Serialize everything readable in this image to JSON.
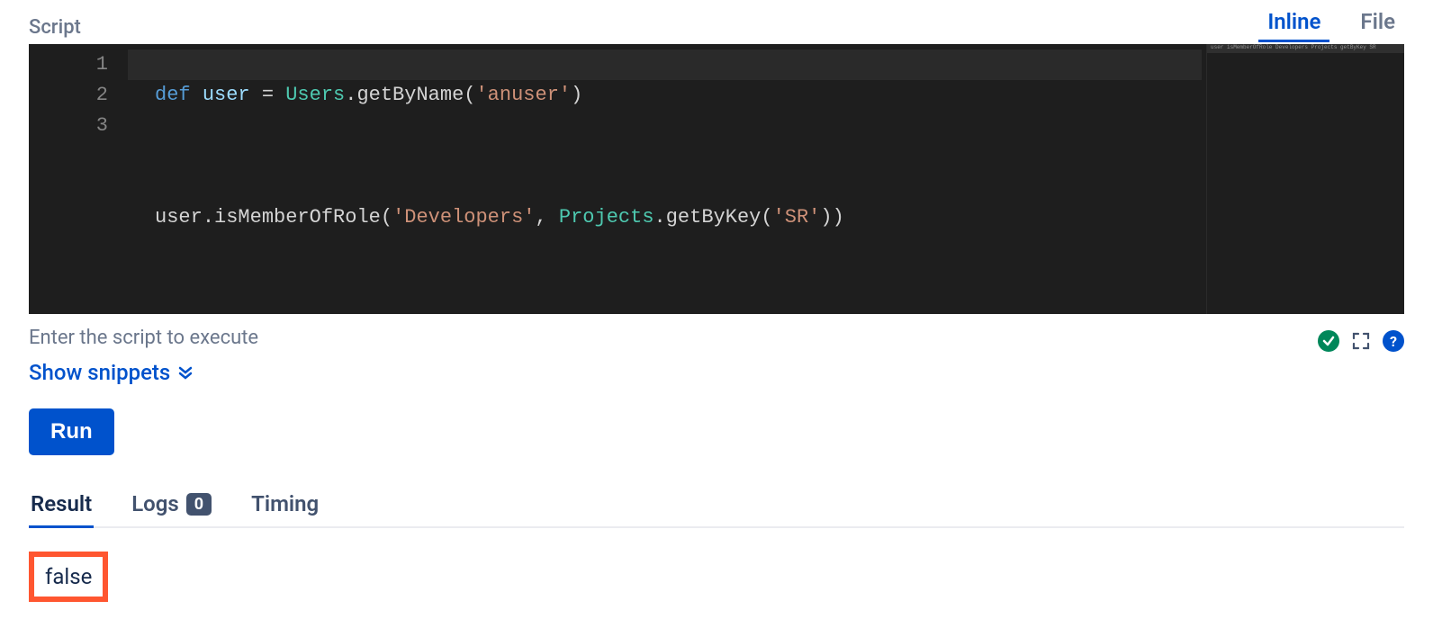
{
  "header": {
    "label": "Script",
    "tabs": [
      {
        "label": "Inline",
        "active": true
      },
      {
        "label": "File",
        "active": false
      }
    ]
  },
  "editor": {
    "lines": [
      "1",
      "2",
      "3"
    ],
    "code_tokens": {
      "line1": {
        "def": "def",
        "sp1": " ",
        "user": "user",
        "sp2": " ",
        "eq": "=",
        "sp3": " ",
        "Users": "Users",
        "dot": ".",
        "getByName": "getByName",
        "lp": "(",
        "str": "'anuser'",
        "rp": ")"
      },
      "line3": {
        "user": "user",
        "dot1": ".",
        "isMember": "isMemberOfRole",
        "lp1": "(",
        "str1": "'Developers'",
        "comma": ",",
        "sp": " ",
        "Projects": "Projects",
        "dot2": ".",
        "getByKey": "getByKey",
        "lp2": "(",
        "str2": "'SR'",
        "rp2": ")",
        "rp1": ")"
      }
    }
  },
  "below": {
    "help": "Enter the script to execute",
    "snippets": "Show snippets"
  },
  "actions": {
    "run": "Run"
  },
  "result_tabs": {
    "result": "Result",
    "logs": "Logs",
    "logs_count": "0",
    "timing": "Timing"
  },
  "result": {
    "value": "false"
  }
}
